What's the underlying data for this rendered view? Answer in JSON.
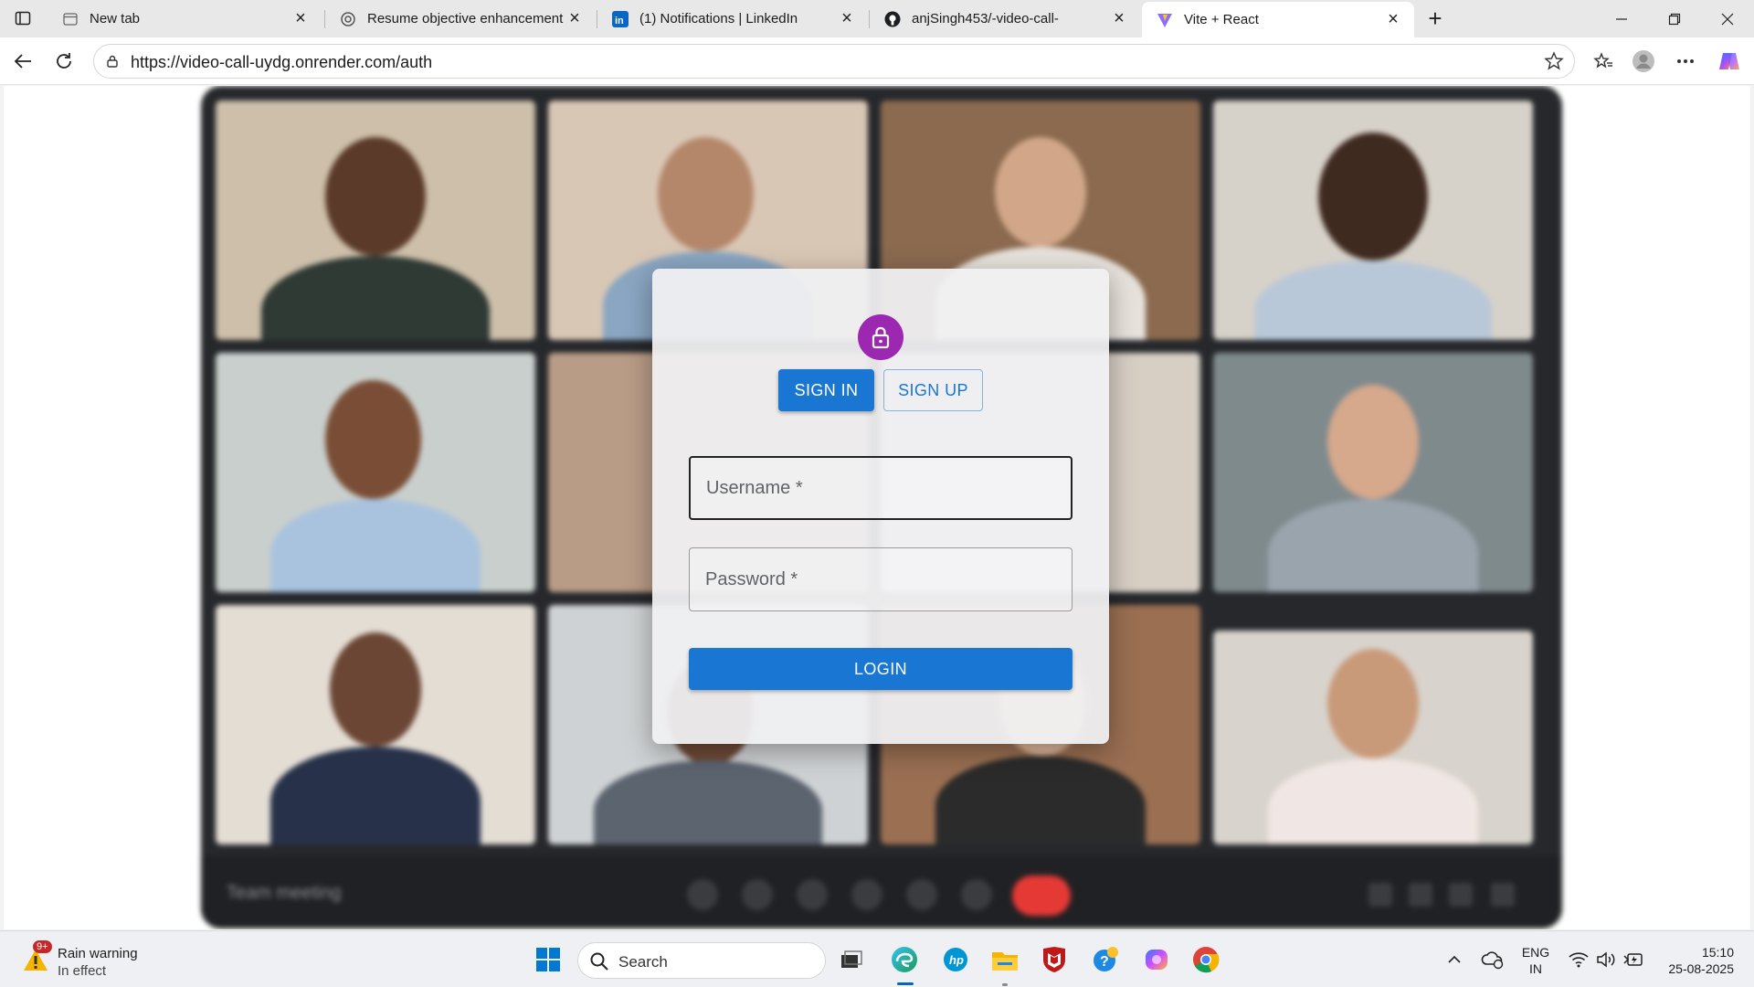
{
  "browser": {
    "tabs": [
      {
        "title": "New tab",
        "icon": "new-tab-page-icon"
      },
      {
        "title": "Resume objective enhancement",
        "icon": "openai-icon"
      },
      {
        "title": "(1) Notifications | LinkedIn",
        "icon": "linkedin-icon"
      },
      {
        "title": "anjSingh453/-video-call-",
        "icon": "github-icon"
      },
      {
        "title": "Vite + React",
        "icon": "vite-icon",
        "active": true
      }
    ],
    "url": "https://video-call-uydg.onrender.com/auth"
  },
  "background": {
    "meeting_name": "Team meeting"
  },
  "auth": {
    "sign_in_label": "SIGN IN",
    "sign_up_label": "SIGN UP",
    "username_placeholder": "Username *",
    "password_placeholder": "Password *",
    "login_label": "LOGIN",
    "accent_color": "#1976d2",
    "avatar_color": "#9c27b0"
  },
  "taskbar": {
    "weather_badge": "9+",
    "weather_title": "Rain warning",
    "weather_subtitle": "In effect",
    "search_placeholder": "Search",
    "language_top": "ENG",
    "language_bottom": "IN",
    "time": "15:10",
    "date": "25-08-2025"
  }
}
